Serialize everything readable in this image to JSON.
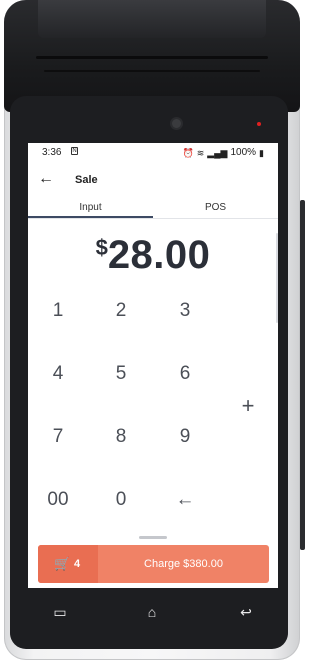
{
  "status": {
    "time": "3:36",
    "battery": "100%"
  },
  "appbar": {
    "title": "Sale"
  },
  "tabs": [
    {
      "label": "Input"
    },
    {
      "label": "POS"
    }
  ],
  "amount": {
    "currency_symbol": "$",
    "value": "28.00"
  },
  "keypad": {
    "keys": [
      "1",
      "2",
      "3",
      "4",
      "5",
      "6",
      "7",
      "8",
      "9",
      "00",
      "0",
      "←"
    ],
    "plus": "+"
  },
  "charge": {
    "cart_count": "4",
    "label": "Charge $380.00"
  },
  "colors": {
    "accent": "#f08266",
    "accent_dark": "#e96e52",
    "tab_indicator": "#3d4a63"
  },
  "icons": {
    "back": "arrow-left-icon",
    "cart": "cart-icon",
    "recent": "recent-apps-icon",
    "home": "home-icon",
    "nav_back": "nav-back-icon"
  }
}
